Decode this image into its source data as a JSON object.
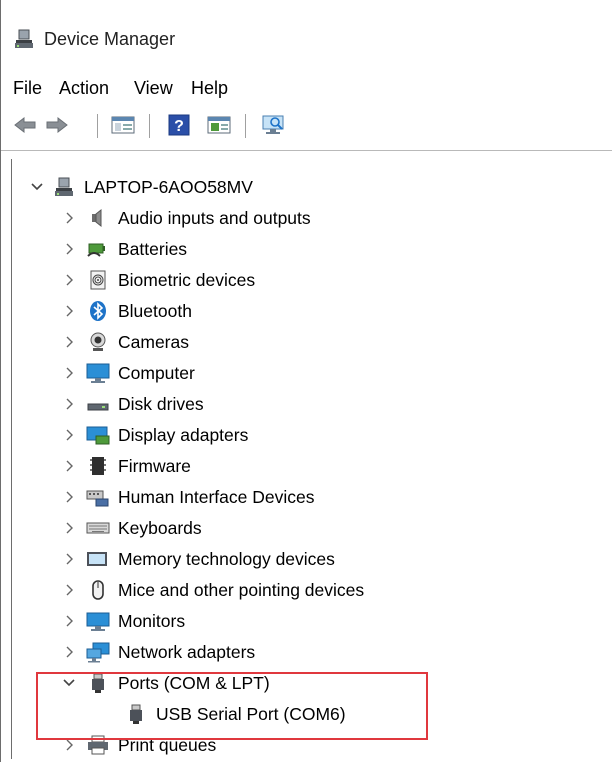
{
  "window": {
    "title": "Device Manager"
  },
  "menu": {
    "items": [
      "File",
      "Action",
      "View",
      "Help"
    ]
  },
  "toolbar": {
    "buttons": [
      "back-icon",
      "forward-icon",
      "show-hide-console-tree-icon",
      "help-icon",
      "properties-icon",
      "scan-hardware-icon"
    ]
  },
  "tree": {
    "root": {
      "label": "LAPTOP-6AOO58MV",
      "expanded": true
    },
    "categories": [
      {
        "label": "Audio inputs and outputs",
        "icon": "speaker-icon",
        "expanded": false
      },
      {
        "label": "Batteries",
        "icon": "battery-icon",
        "expanded": false
      },
      {
        "label": "Biometric devices",
        "icon": "fingerprint-icon",
        "expanded": false
      },
      {
        "label": "Bluetooth",
        "icon": "bluetooth-icon",
        "expanded": false
      },
      {
        "label": "Cameras",
        "icon": "webcam-icon",
        "expanded": false
      },
      {
        "label": "Computer",
        "icon": "monitor-icon",
        "expanded": false
      },
      {
        "label": "Disk drives",
        "icon": "disk-drive-icon",
        "expanded": false
      },
      {
        "label": "Display adapters",
        "icon": "display-adapter-icon",
        "expanded": false
      },
      {
        "label": "Firmware",
        "icon": "chip-icon",
        "expanded": false
      },
      {
        "label": "Human Interface Devices",
        "icon": "hid-icon",
        "expanded": false
      },
      {
        "label": "Keyboards",
        "icon": "keyboard-icon",
        "expanded": false
      },
      {
        "label": "Memory technology devices",
        "icon": "memory-card-icon",
        "expanded": false
      },
      {
        "label": "Mice and other pointing devices",
        "icon": "mouse-icon",
        "expanded": false
      },
      {
        "label": "Monitors",
        "icon": "monitor-icon",
        "expanded": false
      },
      {
        "label": "Network adapters",
        "icon": "network-adapter-icon",
        "expanded": false
      },
      {
        "label": "Ports (COM & LPT)",
        "icon": "port-icon",
        "expanded": true
      },
      {
        "label": "Print queues",
        "icon": "printer-icon",
        "expanded": false
      }
    ],
    "ports_children": [
      {
        "label": "USB Serial Port (COM6)",
        "icon": "port-icon"
      }
    ]
  },
  "colors": {
    "highlight_border": "#e0383e",
    "icon_blue": "#1e73c8"
  }
}
